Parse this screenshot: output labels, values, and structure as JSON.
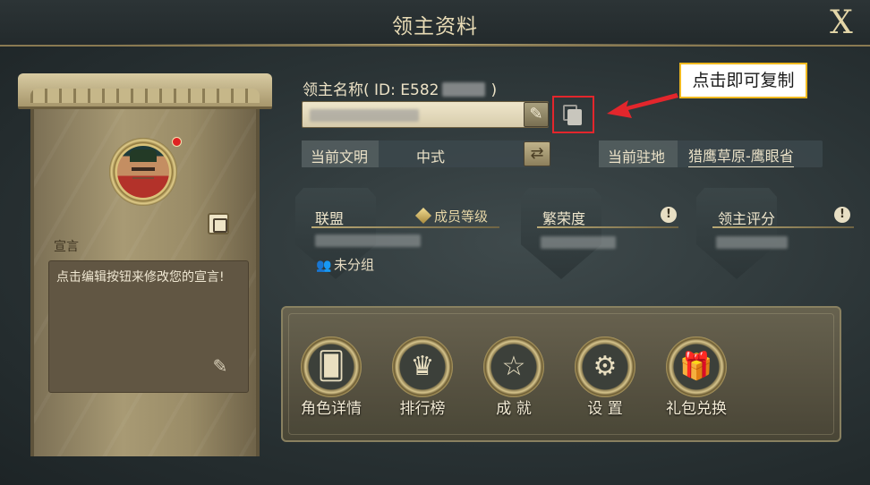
{
  "header": {
    "title": "领主资料",
    "close_label": "X"
  },
  "profile": {
    "declaration_label": "宣言",
    "declaration_text": "点击编辑按钮来修改您的宣言!"
  },
  "lord": {
    "name_label": "领主名称",
    "id_prefix": "( ID: E582",
    "id_suffix": ")"
  },
  "copy_hint": "点击即可复制",
  "civilization": {
    "label": "当前文明",
    "value": "中式"
  },
  "station": {
    "label": "当前驻地",
    "value": "猎鹰草原-鹰眼省"
  },
  "alliance": {
    "label": "联盟",
    "member_level": "成员等级",
    "group": "未分组"
  },
  "prosperity": {
    "label": "繁荣度"
  },
  "rating": {
    "label": "领主评分"
  },
  "menu": [
    {
      "label": "角色详情",
      "icon": "cards-icon"
    },
    {
      "label": "排行榜",
      "icon": "trophy-icon"
    },
    {
      "label": "成 就",
      "icon": "star-icon"
    },
    {
      "label": "设 置",
      "icon": "gear-icon"
    },
    {
      "label": "礼包兑换",
      "icon": "gift-icon"
    }
  ],
  "colors": {
    "highlight_red": "#e3262c",
    "callout_border": "#f0b91f",
    "accent_gold": "#c8b47a"
  }
}
